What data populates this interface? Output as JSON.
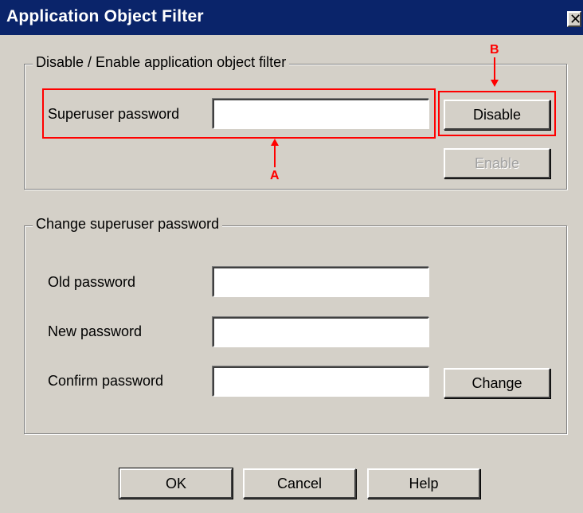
{
  "window": {
    "title": "Application Object Filter",
    "close_glyph": "✕"
  },
  "group_filter": {
    "label": "Disable / Enable application object filter",
    "password_label": "Superuser password",
    "password_value": "",
    "disable_button": "Disable",
    "enable_button": "Enable"
  },
  "group_change": {
    "label": "Change superuser password",
    "old_label": "Old password",
    "new_label": "New password",
    "confirm_label": "Confirm password",
    "old_value": "",
    "new_value": "",
    "confirm_value": "",
    "change_button": "Change"
  },
  "footer": {
    "ok_button": "OK",
    "cancel_button": "Cancel",
    "help_button": "Help"
  },
  "annotations": {
    "a_letter": "A",
    "b_letter": "B",
    "color": "#ff0000"
  },
  "colors": {
    "titlebar": "#0a246a",
    "dialog_bg": "#d4d0c8"
  }
}
